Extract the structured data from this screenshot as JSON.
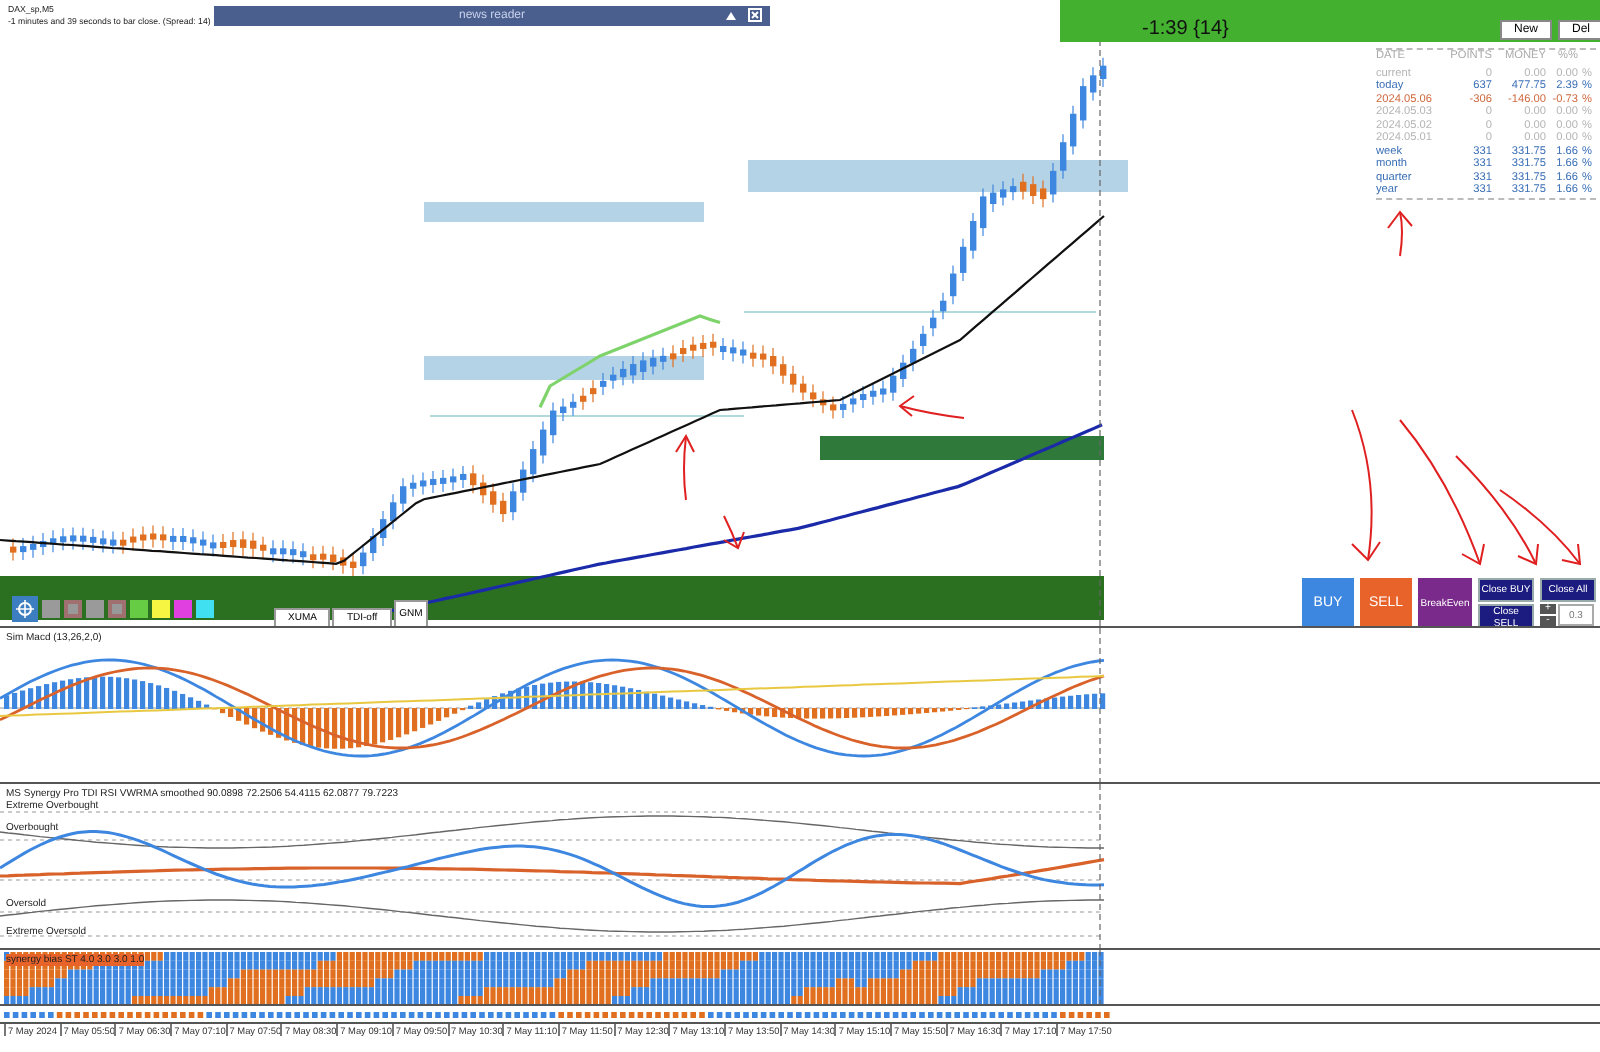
{
  "chart": {
    "symbol": "DAX_sp,M5",
    "countdown": "-1 minutes and 39 seconds to bar close. (Spread: 14)",
    "timer": "-1:39 {14}"
  },
  "news_reader": {
    "title": "news reader"
  },
  "account_panel": {
    "buttons": [
      "New",
      "Del"
    ],
    "columns": [
      "DATE",
      "POINTS",
      "MONEY",
      "%%"
    ],
    "rows": [
      {
        "date": "current",
        "points": "0",
        "money": "0.00",
        "percent": "0.00",
        "unit": "%",
        "kind": "zero"
      },
      {
        "date": "today",
        "points": "637",
        "money": "477.75",
        "percent": "2.39",
        "unit": "%",
        "kind": "profit"
      },
      {
        "date": "2024.05.06",
        "points": "-306",
        "money": "-146.00",
        "percent": "-0.73",
        "unit": "%",
        "kind": "loss"
      },
      {
        "date": "2024.05.03",
        "points": "0",
        "money": "0.00",
        "percent": "0.00",
        "unit": "%",
        "kind": "zero"
      },
      {
        "date": "2024.05.02",
        "points": "0",
        "money": "0.00",
        "percent": "0.00",
        "unit": "%",
        "kind": "zero"
      },
      {
        "date": "2024.05.01",
        "points": "0",
        "money": "0.00",
        "percent": "0.00",
        "unit": "%",
        "kind": "zero"
      },
      {
        "date": "week",
        "points": "331",
        "money": "331.75",
        "percent": "1.66",
        "unit": "%",
        "kind": "profit"
      },
      {
        "date": "month",
        "points": "331",
        "money": "331.75",
        "percent": "1.66",
        "unit": "%",
        "kind": "profit"
      },
      {
        "date": "quarter",
        "points": "331",
        "money": "331.75",
        "percent": "1.66",
        "unit": "%",
        "kind": "profit"
      },
      {
        "date": "year",
        "points": "331",
        "money": "331.75",
        "percent": "1.66",
        "unit": "%",
        "kind": "profit"
      }
    ]
  },
  "trade_buttons": [
    {
      "label": "BUY",
      "kind": "buy"
    },
    {
      "label": "SELL",
      "kind": "sell"
    },
    {
      "label": "BreakEven",
      "kind": "breakeven"
    },
    {
      "label": "Close BUY",
      "kind": "close"
    },
    {
      "label": "Close SELL",
      "kind": "close"
    },
    {
      "label": "Close All",
      "kind": "close"
    }
  ],
  "lot": {
    "plus": "+",
    "minus": "-",
    "value": "0.3"
  },
  "toolbar": {
    "swatches": [
      {
        "color": "#9a9a9a"
      },
      {
        "color": "#a07070"
      },
      {
        "color": "#9a9a9a"
      },
      {
        "color": "#a07070"
      },
      {
        "color": "#66cc44"
      },
      {
        "color": "#f5f542"
      },
      {
        "color": "#e040e0"
      },
      {
        "color": "#40e0f0"
      }
    ],
    "buttons": [
      "XUMA",
      "TDI-off",
      "GNM"
    ]
  },
  "indicators": [
    {
      "title": "Sim Macd (13,26,2,0)"
    },
    {
      "title": "MS Synergy Pro TDI RSI VWRMA smoothed  90.0898 72.2506 54.4115 62.0877 79.7223",
      "levels": [
        "Extreme Overbought",
        "Overbought",
        "Oversold",
        "Extreme Oversold"
      ]
    },
    {
      "title": "synergy bias ST 4.0 3.0 3.0 1.0"
    }
  ],
  "time_axis": [
    "7 May 2024",
    "7 May 05:50",
    "7 May 06:30",
    "7 May 07:10",
    "7 May 07:50",
    "7 May 08:30",
    "7 May 09:10",
    "7 May 09:50",
    "7 May 10:30",
    "7 May 11:10",
    "7 May 11:50",
    "7 May 12:30",
    "7 May 13:10",
    "7 May 13:50",
    "7 May 14:30",
    "7 May 15:10",
    "7 May 15:50",
    "7 May 16:30",
    "7 May 17:10",
    "7 May 17:50"
  ]
}
